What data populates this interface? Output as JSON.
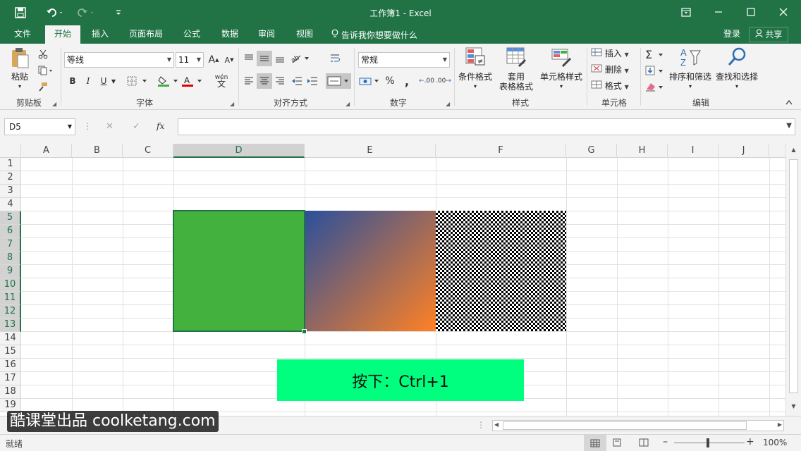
{
  "window": {
    "title": "工作簿1 - Excel"
  },
  "tabs": [
    {
      "label": "文件",
      "active": false
    },
    {
      "label": "开始",
      "active": true
    },
    {
      "label": "插入",
      "active": false
    },
    {
      "label": "页面布局",
      "active": false
    },
    {
      "label": "公式",
      "active": false
    },
    {
      "label": "数据",
      "active": false
    },
    {
      "label": "审阅",
      "active": false
    },
    {
      "label": "视图",
      "active": false
    }
  ],
  "tell_me": "告诉我你想要做什么",
  "account": {
    "login": "登录",
    "share": "共享"
  },
  "ribbon": {
    "clipboard": {
      "group": "剪贴板",
      "paste": "粘贴"
    },
    "font": {
      "group": "字体",
      "name": "等线",
      "size": "11",
      "bold": "B",
      "italic": "I",
      "underline": "U",
      "grow": "A",
      "shrink": "A",
      "phonetic": "wén"
    },
    "alignment": {
      "group": "对齐方式"
    },
    "number": {
      "group": "数字",
      "format": "常规",
      "percent": "%",
      "comma": ",",
      "inc_decimal": ".00",
      "dec_decimal": ".00"
    },
    "styles": {
      "group": "样式",
      "conditional": "条件格式",
      "table_1": "套用",
      "table_2": "表格格式",
      "cell_styles": "单元格样式"
    },
    "cells": {
      "group": "单元格",
      "insert": "插入",
      "delete": "删除",
      "format": "格式"
    },
    "editing": {
      "group": "编辑",
      "sort": "排序和筛选",
      "find": "查找和选择"
    }
  },
  "formula_bar": {
    "name_box": "D5",
    "cancel": "✕",
    "enter": "✓",
    "fx": "fx",
    "content": ""
  },
  "grid": {
    "columns": [
      "A",
      "B",
      "C",
      "D",
      "E",
      "F",
      "G",
      "H",
      "I",
      "J"
    ],
    "selected_column": "D",
    "rows": [
      "1",
      "2",
      "3",
      "4",
      "5",
      "6",
      "7",
      "8",
      "9",
      "10",
      "11",
      "12",
      "13",
      "14",
      "15",
      "16",
      "17",
      "18",
      "19"
    ],
    "selected_rows": [
      "5",
      "6",
      "7",
      "8",
      "9",
      "10",
      "11",
      "12",
      "13"
    ],
    "active_cell": "D5",
    "fills": {
      "solid": "#43b13d",
      "gradient_start": "#2a4f9c",
      "gradient_end": "#ff8124",
      "pattern_dark": "#000000",
      "pattern_light": "#ffffff"
    }
  },
  "hint": {
    "text": "按下：Ctrl+1",
    "color": "#00ff7e"
  },
  "status": {
    "ready": "就绪",
    "zoom": "100%"
  },
  "watermark": "酷课堂出品 coolketang.com",
  "colors": {
    "brand": "#217346"
  }
}
